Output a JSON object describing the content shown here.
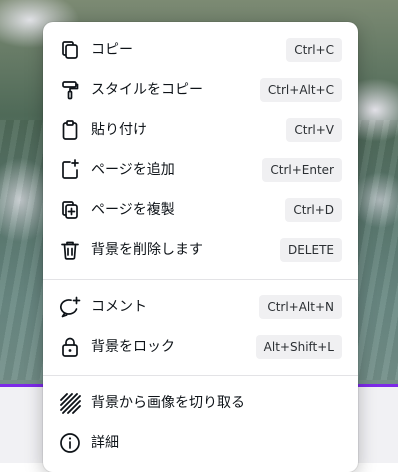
{
  "menu": {
    "items": [
      {
        "label": "コピー",
        "shortcut": "Ctrl+C",
        "icon": "copy-icon"
      },
      {
        "label": "スタイルをコピー",
        "shortcut": "Ctrl+Alt+C",
        "icon": "paint-roller-icon"
      },
      {
        "label": "貼り付け",
        "shortcut": "Ctrl+V",
        "icon": "clipboard-icon"
      },
      {
        "label": "ページを追加",
        "shortcut": "Ctrl+Enter",
        "icon": "add-page-icon"
      },
      {
        "label": "ページを複製",
        "shortcut": "Ctrl+D",
        "icon": "duplicate-page-icon"
      },
      {
        "label": "背景を削除します",
        "shortcut": "DELETE",
        "icon": "trash-icon"
      },
      {
        "label": "コメント",
        "shortcut": "Ctrl+Alt+N",
        "icon": "comment-add-icon"
      },
      {
        "label": "背景をロック",
        "shortcut": "Alt+Shift+L",
        "icon": "lock-icon"
      },
      {
        "label": "背景から画像を切り取る",
        "icon": "striped-crop-icon"
      },
      {
        "label": "詳細",
        "icon": "info-icon"
      }
    ]
  },
  "colors": {
    "accent": "#7d2ae8",
    "shortcut_bg": "#f0f0f2",
    "text": "#0e1318"
  }
}
